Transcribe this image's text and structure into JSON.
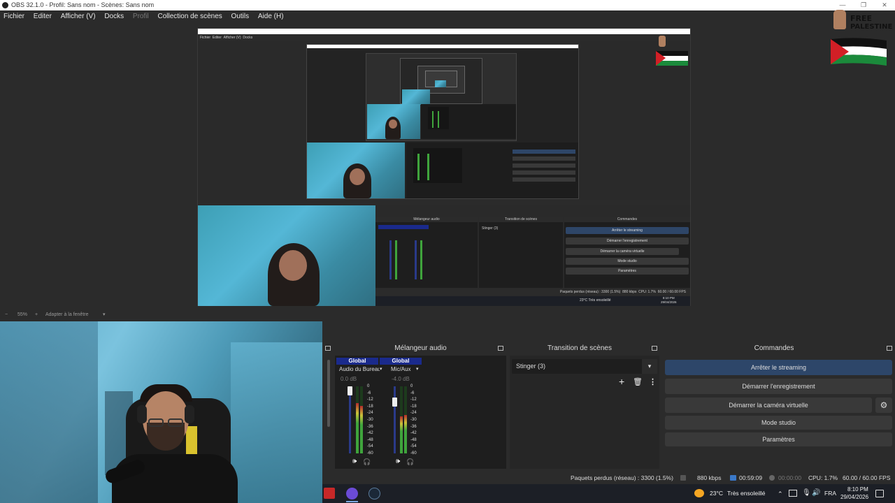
{
  "window": {
    "title": "OBS 32.1.0 - Profil: Sans nom - Scènes: Sans nom"
  },
  "menu": [
    {
      "label": "Fichier",
      "enabled": true
    },
    {
      "label": "Editer",
      "enabled": true
    },
    {
      "label": "Afficher (V)",
      "enabled": true
    },
    {
      "label": "Docks",
      "enabled": true
    },
    {
      "label": "Profil",
      "enabled": false
    },
    {
      "label": "Collection de scènes",
      "enabled": true
    },
    {
      "label": "Outils",
      "enabled": true
    },
    {
      "label": "Aide (H)",
      "enabled": true
    }
  ],
  "overlay": {
    "line1": "FREE",
    "line2": "PALESTINE"
  },
  "preview_toolbar": {
    "zoom_minus": "−",
    "zoom_value": "55%",
    "zoom_plus": "+",
    "fit_label": "Adapter à la fenêtre"
  },
  "mixer": {
    "title": "Mélangeur audio",
    "channels": [
      {
        "header": "Global",
        "name": "Audio du Bureau",
        "db": "0.0 dB",
        "level": 0.75
      },
      {
        "header": "Global",
        "name": "Mic/Aux",
        "db": "-4.0 dB",
        "level": 0.55
      }
    ],
    "scale": [
      "0",
      "-6",
      "-12",
      "-18",
      "-24",
      "-30",
      "-36",
      "-42",
      "-48",
      "-54",
      "-60"
    ]
  },
  "transitions": {
    "title": "Transition de scènes",
    "selected": "Stinger (3)"
  },
  "controls": {
    "title": "Commandes",
    "stop_streaming": "Arrêter le streaming",
    "start_recording": "Démarrer l'enregistrement",
    "start_virtualcam": "Démarrer la caméra virtuelle",
    "studio_mode": "Mode studio",
    "settings": "Paramètres"
  },
  "status": {
    "dropped": "Paquets perdus (réseau) : 3300 (1.5%)",
    "bitrate": "880 kbps",
    "stream_time": "00:59:09",
    "rec_time": "00:00:00",
    "cpu": "CPU: 1.7%",
    "fps": "60.00 / 60.00 FPS"
  },
  "taskbar": {
    "weather_temp": "23°C",
    "weather_desc": "Très ensoleillé",
    "lang": "FRA",
    "time": "8:10 PM",
    "date": "29/04/2026"
  },
  "colors": {
    "accent_active": "#2d4669",
    "mixer_header": "#1a2a8c",
    "meter_green": "#3fa43c",
    "meter_yellow": "#c9c23a",
    "meter_red": "#b52a2a"
  }
}
